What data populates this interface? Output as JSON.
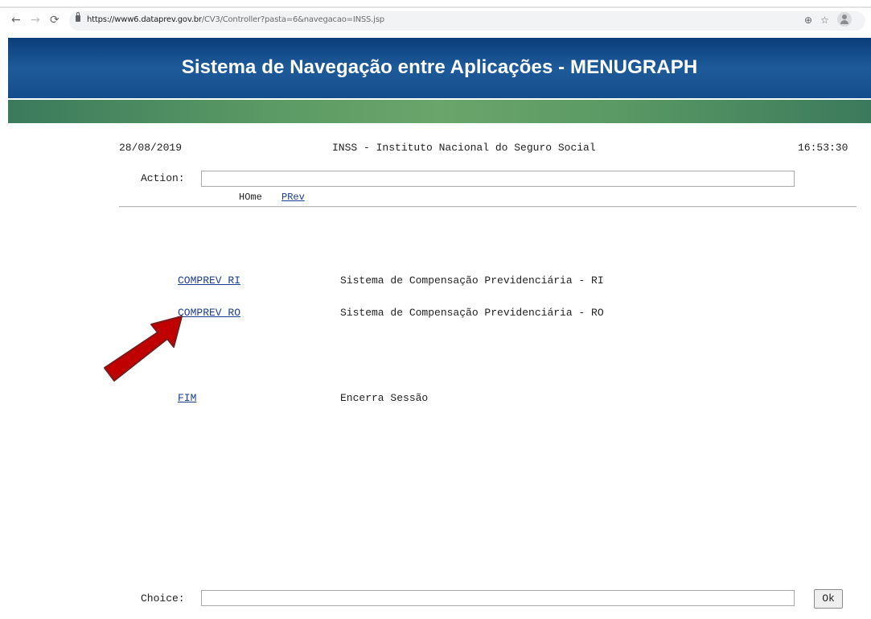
{
  "browser": {
    "url_host": "https://www6.dataprev.gov.br",
    "url_path": "/CV3/Controller?pasta=6&navegacao=INSS.jsp"
  },
  "banner": {
    "title": "Sistema de Navegação entre Aplicações - MENUGRAPH"
  },
  "header": {
    "date": "28/08/2019",
    "org": "INSS - Instituto Nacional do Seguro Social",
    "time": "16:53:30"
  },
  "action": {
    "label": "Action:",
    "value": ""
  },
  "nav": {
    "home": "HOme",
    "prev": "PRev"
  },
  "menu": [
    {
      "code": "COMPREV RI",
      "desc": "Sistema de Compensação Previdenciária - RI"
    },
    {
      "code": "COMPREV RO",
      "desc": "Sistema de Compensação Previdenciária - RO"
    },
    {
      "code": "FIM",
      "desc": "Encerra Sessão"
    }
  ],
  "choice": {
    "label": "Choice:",
    "value": "",
    "ok": "Ok"
  },
  "colors": {
    "arrow": "#c00000",
    "banner": "#154d8c",
    "link": "#1a3d8f"
  },
  "icons": [
    "back-icon",
    "forward-icon",
    "reload-icon",
    "lock-icon",
    "zoom-icon",
    "star-icon",
    "profile-icon",
    "arrow-annotation-icon"
  ]
}
